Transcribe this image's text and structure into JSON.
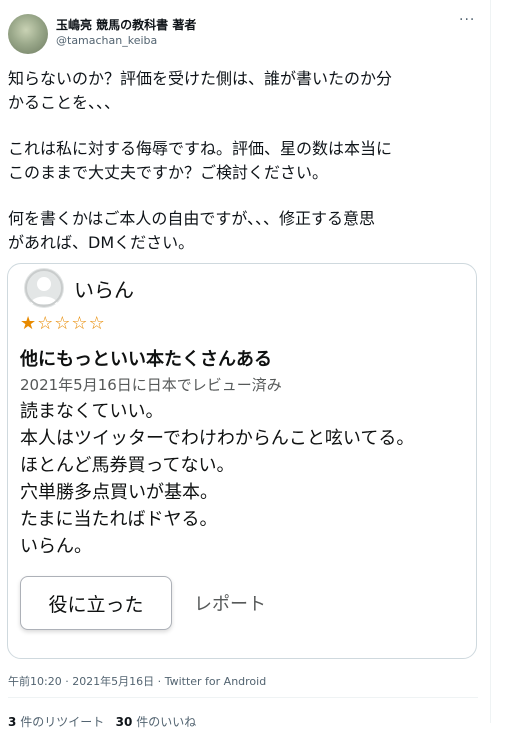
{
  "author": {
    "display_name": "玉嶋亮 競馬の教科書 著者",
    "handle": "@tamachan_keiba",
    "more_icon": "more-icon"
  },
  "tweet": {
    "paragraphs": [
      [
        "知らないのか？評価を受けた側は、誰が書いたのか分",
        "かることを、、、"
      ],
      [
        "これは私に対する侮辱ですね。評価、星の数は本当に",
        "このままで大丈夫ですか？ご検討ください。"
      ],
      [
        "何を書くかはご本人の自由ですが、、、修正する意思",
        "があれば、DMください。"
      ]
    ]
  },
  "review": {
    "reviewer_name": "いらん",
    "rating": 1,
    "rating_max": 5,
    "star_color": "#e88a00",
    "title": "他にもっといい本たくさんある",
    "date_line": "2021年5月16日に日本でレビュー済み",
    "body_lines": [
      "読まなくていい。",
      "本人はツイッターでわけわからんこと呟いてる。",
      "ほとんど馬券買ってない。",
      "穴単勝多点買いが基本。",
      "たまに当たればドヤる。",
      "いらん。"
    ],
    "helpful_label": "役に立った",
    "report_label": "レポート"
  },
  "meta": {
    "timestamp": "午前10:20 · 2021年5月16日",
    "client": "Twitter for Android"
  },
  "stats": {
    "retweets_count": "3",
    "retweets_label": "件のリツイート",
    "likes_count": "30",
    "likes_label": "件のいいね"
  }
}
